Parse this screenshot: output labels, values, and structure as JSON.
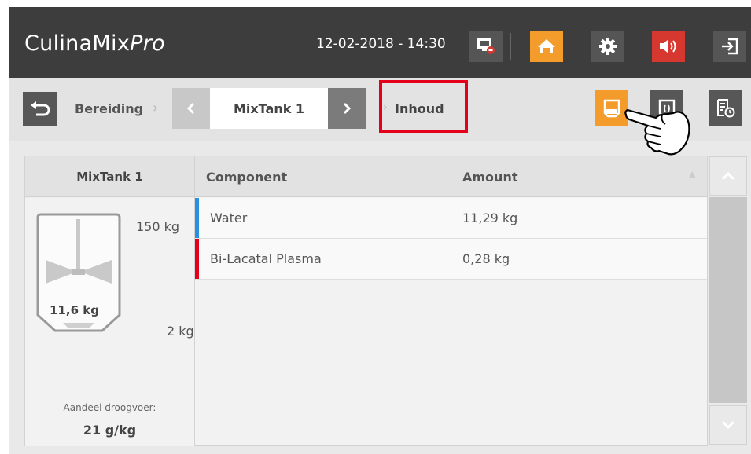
{
  "header": {
    "app_name": "CulinaMix",
    "app_name_suffix": "Pro",
    "datetime": "12-02-2018 - 14:30",
    "buttons": [
      {
        "icon": "display-alert-icon",
        "color": "#555555"
      },
      {
        "icon": "home-icon",
        "color": "#f39c2b"
      },
      {
        "icon": "gear-icon",
        "color": "#555555"
      },
      {
        "icon": "speaker-icon",
        "color": "#d6382f"
      },
      {
        "icon": "logout-icon",
        "color": "#555555"
      }
    ]
  },
  "breadcrumb": {
    "back_icon": "back-arrow-icon",
    "first": "Bereiding",
    "selector_value": "MixTank 1",
    "current": "Inhoud"
  },
  "view_buttons": [
    {
      "icon": "tank-content-icon",
      "active": true,
      "color": "#f39c2b"
    },
    {
      "icon": "tank-sensor-icon",
      "active": false
    },
    {
      "icon": "list-clock-icon",
      "active": false
    }
  ],
  "tank": {
    "title": "MixTank 1",
    "max_label": "150 kg",
    "min_label": "2 kg",
    "fill_label": "11,6 kg",
    "share_label": "Aandeel droogvoer:",
    "share_value": "21 g/kg"
  },
  "table": {
    "headers": [
      "Component",
      "Amount"
    ],
    "rows": [
      {
        "component": "Water",
        "amount": "11,29 kg",
        "color": "#2a8fe0"
      },
      {
        "component": "Bi-Lacatal Plasma",
        "amount": "0,28 kg",
        "color": "#e4001b"
      }
    ]
  },
  "colors": {
    "accent_orange": "#f39c2b",
    "alert_red": "#d6382f",
    "highlight_red": "#e4001b",
    "topbar": "#3d3d3d"
  }
}
